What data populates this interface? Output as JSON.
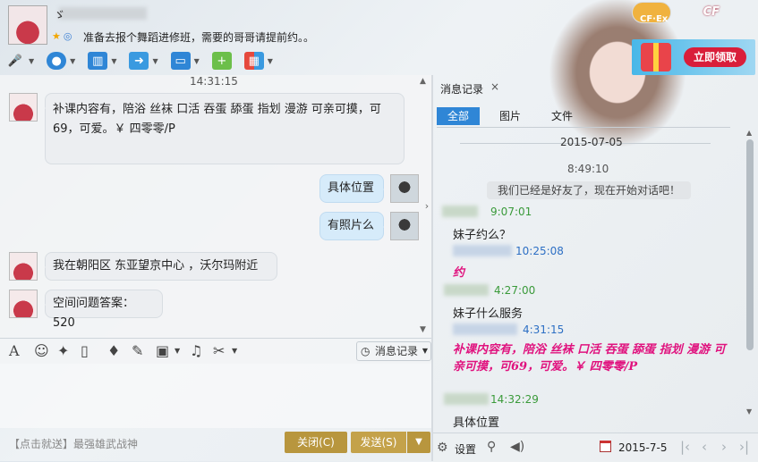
{
  "header": {
    "nickname": "ゞ",
    "signature": "准备去报个舞蹈进修班，需要的哥哥请提前约。。",
    "status_icons": [
      "star-icon",
      "qq-icon"
    ]
  },
  "toolbar": {
    "items": [
      "microphone-icon",
      "video-camera-icon",
      "presentation-icon",
      "file-transfer-icon",
      "remote-desktop-icon",
      "new-message-icon",
      "apps-grid-icon"
    ]
  },
  "banner": {
    "game_logo_text": "CF",
    "game_logo_bubble": "CF·Ex",
    "ad_button": "立即领取"
  },
  "chat": {
    "time_label": "14:31:15",
    "messages": [
      {
        "sender": "other",
        "text": "补课内容有，陪浴 丝袜  口活 吞蛋 舔蛋 指划 漫游 可亲可摸，可69，可爱。￥ 四零零/P"
      },
      {
        "sender": "self",
        "text": "具体位置"
      },
      {
        "sender": "self",
        "text": "有照片么"
      },
      {
        "sender": "other",
        "text": "我在朝阳区  东亚望京中心  ，沃尔玛附近"
      },
      {
        "sender": "other",
        "text": "空间问题答案：520"
      }
    ]
  },
  "input_toolbar": {
    "icons": [
      "font-icon",
      "emoji-icon",
      "shake-icon",
      "screenshot-icon",
      "voice-icon",
      "edit-icon",
      "image-icon",
      "music-icon",
      "scissors-icon"
    ],
    "message_record_label": "消息记录"
  },
  "bottom": {
    "ad_text": "【点击就送】最强雄武战神",
    "close_label": "关闭(C)",
    "send_label": "发送(S)"
  },
  "history": {
    "tab_label": "消息记录",
    "tab_close": "×",
    "filters": [
      "全部",
      "图片",
      "文件"
    ],
    "date": "2015-07-05",
    "time0": "8:49:10",
    "system_message": "我们已经是好友了，现在开始对话吧！",
    "entries": [
      {
        "time": "9:07:01",
        "time_color": "green",
        "text": "妹子约么？",
        "style": "normal"
      },
      {
        "time": "10:25:08",
        "time_color": "blue",
        "text": "约",
        "style": "pink"
      },
      {
        "time": "4:27:00",
        "time_color": "green",
        "text": "妹子什么服务",
        "style": "normal"
      },
      {
        "time": "4:31:15",
        "time_color": "blue",
        "text": "补课内容有，陪浴 丝袜  口活 吞蛋 舔蛋 指划 漫游 可亲可摸，可69，可爱。￥ 四零零/P",
        "style": "pink"
      },
      {
        "time": "14:32:29",
        "time_color": "green",
        "text": "具体位置",
        "style": "normal"
      }
    ],
    "footer": {
      "settings_label": "设置",
      "date": "2015-7-5"
    }
  }
}
